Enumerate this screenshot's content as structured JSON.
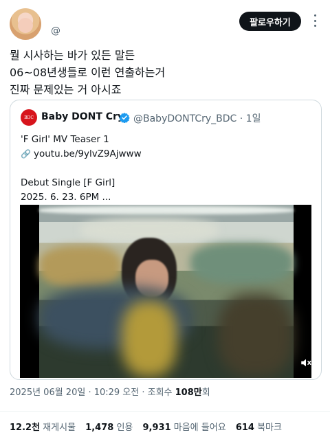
{
  "header": {
    "handle": "@　",
    "follow_label": "팔로우하기"
  },
  "tweet": {
    "lines": [
      "뭘 시사하는 바가 있든 말든",
      "06~08년생들로 이런 연출하는거",
      "진짜 문제있는 거 아시죠"
    ]
  },
  "quote": {
    "avatar_text": "BDC",
    "name": "Baby DONT Cry",
    "handle_time": "@BabyDONTCry_BDC · 1일",
    "body": [
      "'F Girl' MV Teaser 1",
      "youtu.be/9ylvZ9Ajwww",
      "",
      "Debut Single [F Girl]",
      "2025. 6. 23. 6PM ..."
    ],
    "link_icon": "link-icon"
  },
  "meta": {
    "date_time": "2025년 06월 20일 · 10:29 오전 · 조회수 ",
    "views": "108만",
    "views_suffix": "회"
  },
  "stats": {
    "retweets": "12.2천",
    "retweets_label": "재게시물",
    "quotes": "1,478",
    "quotes_label": "인용",
    "likes": "9,931",
    "likes_label": "마음에 들어요",
    "bookmarks": "614",
    "bookmarks_label": "북마크"
  },
  "colors": {
    "primary_text": "#0f1419",
    "secondary_text": "#536471",
    "verified": "#1d9bf0",
    "follow_bg": "#0f1419"
  }
}
